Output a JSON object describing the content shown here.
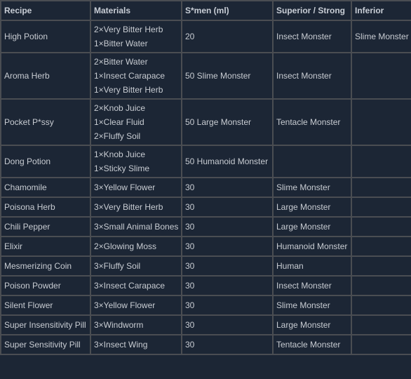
{
  "table": {
    "headers": [
      "Recipe",
      "Materials",
      "S*men (ml)",
      "Superior / Strong",
      "Inferior"
    ],
    "rows": [
      {
        "recipe": "High Potion",
        "materials": [
          "2×Very Bitter Herb",
          "1×Bitter Water"
        ],
        "semen": "20",
        "superior": "Insect Monster",
        "inferior": "Slime Monster"
      },
      {
        "recipe": "Aroma Herb",
        "materials": [
          "2×Bitter Water",
          "1×Insect Carapace",
          "1×Very Bitter Herb"
        ],
        "semen": "50 Slime Monster",
        "superior": "Insect Monster",
        "inferior": ""
      },
      {
        "recipe": "Pocket P*ssy",
        "materials": [
          "2×Knob Juice",
          "1×Clear Fluid",
          "2×Fluffy Soil"
        ],
        "semen": "50 Large Monster",
        "superior": "Tentacle Monster",
        "inferior": ""
      },
      {
        "recipe": "Dong Potion",
        "materials": [
          "1×Knob Juice",
          "1×Sticky Slime"
        ],
        "semen": "50 Humanoid Monster",
        "superior": "",
        "inferior": ""
      },
      {
        "recipe": "Chamomile",
        "materials": [
          "3×Yellow Flower"
        ],
        "semen": "30",
        "superior": "Slime Monster",
        "inferior": ""
      },
      {
        "recipe": "Poisona Herb",
        "materials": [
          "3×Very Bitter Herb"
        ],
        "semen": "30",
        "superior": "Large Monster",
        "inferior": ""
      },
      {
        "recipe": "Chili Pepper",
        "materials": [
          "3×Small Animal Bones"
        ],
        "semen": "30",
        "superior": "Large Monster",
        "inferior": ""
      },
      {
        "recipe": "Elixir",
        "materials": [
          "2×Glowing Moss"
        ],
        "semen": "30",
        "superior": "Humanoid Monster",
        "inferior": ""
      },
      {
        "recipe": "Mesmerizing Coin",
        "materials": [
          "3×Fluffy Soil"
        ],
        "semen": "30",
        "superior": "Human",
        "inferior": ""
      },
      {
        "recipe": "Poison Powder",
        "materials": [
          "3×Insect Carapace"
        ],
        "semen": "30",
        "superior": "Insect Monster",
        "inferior": ""
      },
      {
        "recipe": "Silent Flower",
        "materials": [
          "3×Yellow Flower"
        ],
        "semen": "30",
        "superior": "Slime Monster",
        "inferior": ""
      },
      {
        "recipe": "Super Insensitivity Pill",
        "materials": [
          "3×Windworm"
        ],
        "semen": "30",
        "superior": "Large Monster",
        "inferior": ""
      },
      {
        "recipe": "Super Sensitivity Pill",
        "materials": [
          "3×Insect Wing"
        ],
        "semen": "30",
        "superior": "Tentacle Monster",
        "inferior": ""
      }
    ]
  }
}
